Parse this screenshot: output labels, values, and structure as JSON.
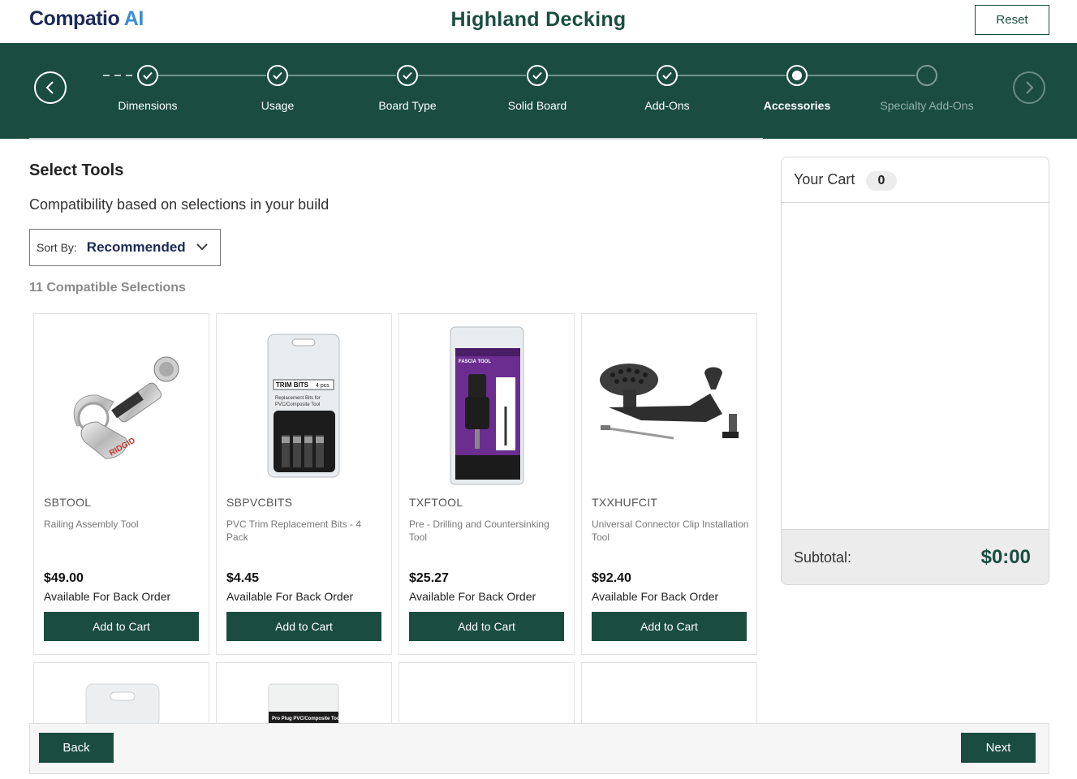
{
  "header": {
    "logo_part1": "Compatio",
    "logo_part2": " AI",
    "title": "Highland Decking",
    "reset_label": "Reset"
  },
  "stepper": {
    "steps": [
      {
        "label": "Dimensions",
        "state": "complete"
      },
      {
        "label": "Usage",
        "state": "complete"
      },
      {
        "label": "Board Type",
        "state": "complete"
      },
      {
        "label": "Solid Board",
        "state": "complete"
      },
      {
        "label": "Add-Ons",
        "state": "complete"
      },
      {
        "label": "Accessories",
        "state": "active"
      },
      {
        "label": "Specialty Add-Ons",
        "state": "future"
      }
    ]
  },
  "main": {
    "title": "Select Tools",
    "subtitle": "Compatibility based on selections in your build",
    "sort_label": "Sort By:",
    "sort_value": "Recommended",
    "count_text": "11 Compatible Selections"
  },
  "products": [
    {
      "sku": "SBTOOL",
      "name": "Railing Assembly Tool",
      "price": "$49.00",
      "availability": "Available For Back Order",
      "button": "Add to Cart",
      "image_icon": "pipe-cutter-icon"
    },
    {
      "sku": "SBPVCBITS",
      "name": "PVC Trim Replacement Bits - 4 Pack",
      "price": "$4.45",
      "availability": "Available For Back Order",
      "button": "Add to Cart",
      "image_icon": "drill-bits-package-icon",
      "package_title": "TRIM BITS",
      "package_count": "4 pcs",
      "package_sub": "Replacement Bits for PVC/Composite Tool"
    },
    {
      "sku": "TXFTOOL",
      "name": "Pre - Drilling and Countersinking Tool",
      "price": "$25.27",
      "availability": "Available For Back Order",
      "button": "Add to Cart",
      "image_icon": "fascia-tool-package-icon",
      "package_title": "FASCIA TOOL"
    },
    {
      "sku": "TXXHUFCIT",
      "name": "Universal Connector Clip Installation Tool",
      "price": "$92.40",
      "availability": "Available For Back Order",
      "button": "Add to Cart",
      "image_icon": "clip-installation-tool-icon"
    }
  ],
  "partial_products": [
    {
      "image_icon": "package-icon"
    },
    {
      "image_icon": "package-icon",
      "package_title": "Pro Plug PVC/Composite Tool"
    },
    {
      "image_icon": "blank-image"
    },
    {
      "image_icon": "blank-image"
    }
  ],
  "cart": {
    "title": "Your Cart",
    "count": "0",
    "subtotal_label": "Subtotal:",
    "subtotal_value": "$0:00"
  },
  "footer": {
    "back_label": "Back",
    "next_label": "Next"
  },
  "colors": {
    "brand_green": "#1a4d40",
    "logo_navy": "#1c2a5a",
    "logo_blue": "#3a8fd6"
  }
}
